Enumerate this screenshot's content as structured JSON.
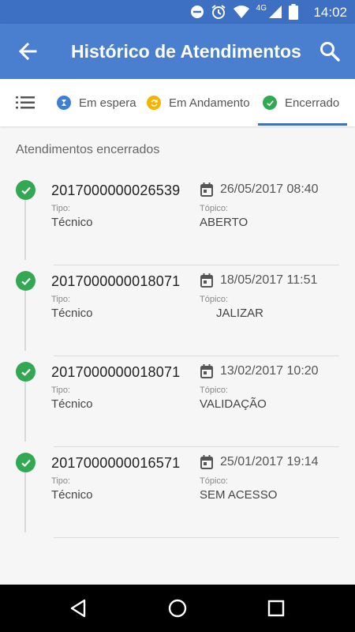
{
  "status_bar": {
    "time": "14:02",
    "network": "4G",
    "icons": [
      "do-not-disturb-icon",
      "alarm-icon",
      "wifi-icon",
      "signal-icon",
      "battery-icon"
    ]
  },
  "app_bar": {
    "title": "Histórico de Atendimentos",
    "back_icon": "arrow-back-icon",
    "search_icon": "search-icon",
    "color": "#4a7fd0"
  },
  "tabs": {
    "menu_icon": "list-icon",
    "items": [
      {
        "label": "Em espera",
        "icon": "hourglass-icon",
        "color": "#3d7fd6"
      },
      {
        "label": "Em Andamento",
        "icon": "sync-icon",
        "color": "#f5b400"
      },
      {
        "label": "Encerrado",
        "icon": "check-icon",
        "color": "#32a852",
        "selected": true
      }
    ]
  },
  "section_title": "Atendimentos encerrados",
  "list": [
    {
      "number": "2017000000026539",
      "date": "26/05/2017 08:40",
      "tipo_label": "Tipo:",
      "tipo": "Técnico",
      "topico_label": "Tópico:",
      "topico": "ABERTO"
    },
    {
      "number": "2017000000018071",
      "date": "18/05/2017 11:51",
      "tipo_label": "Tipo:",
      "tipo": "Técnico",
      "topico_label": "Tópico:",
      "topico": "JALIZAR"
    },
    {
      "number": "2017000000018071",
      "date": "13/02/2017 10:20",
      "tipo_label": "Tipo:",
      "tipo": "Técnico",
      "topico_label": "Tópico:",
      "topico": "VALIDAÇÃO"
    },
    {
      "number": "2017000000016571",
      "date": "25/01/2017 19:14",
      "tipo_label": "Tipo:",
      "tipo": "Técnico",
      "topico_label": "Tópico:",
      "topico": "SEM ACESSO"
    }
  ],
  "nav_bar": {
    "icons": [
      "back-triangle-icon",
      "home-circle-icon",
      "recents-square-icon"
    ]
  }
}
